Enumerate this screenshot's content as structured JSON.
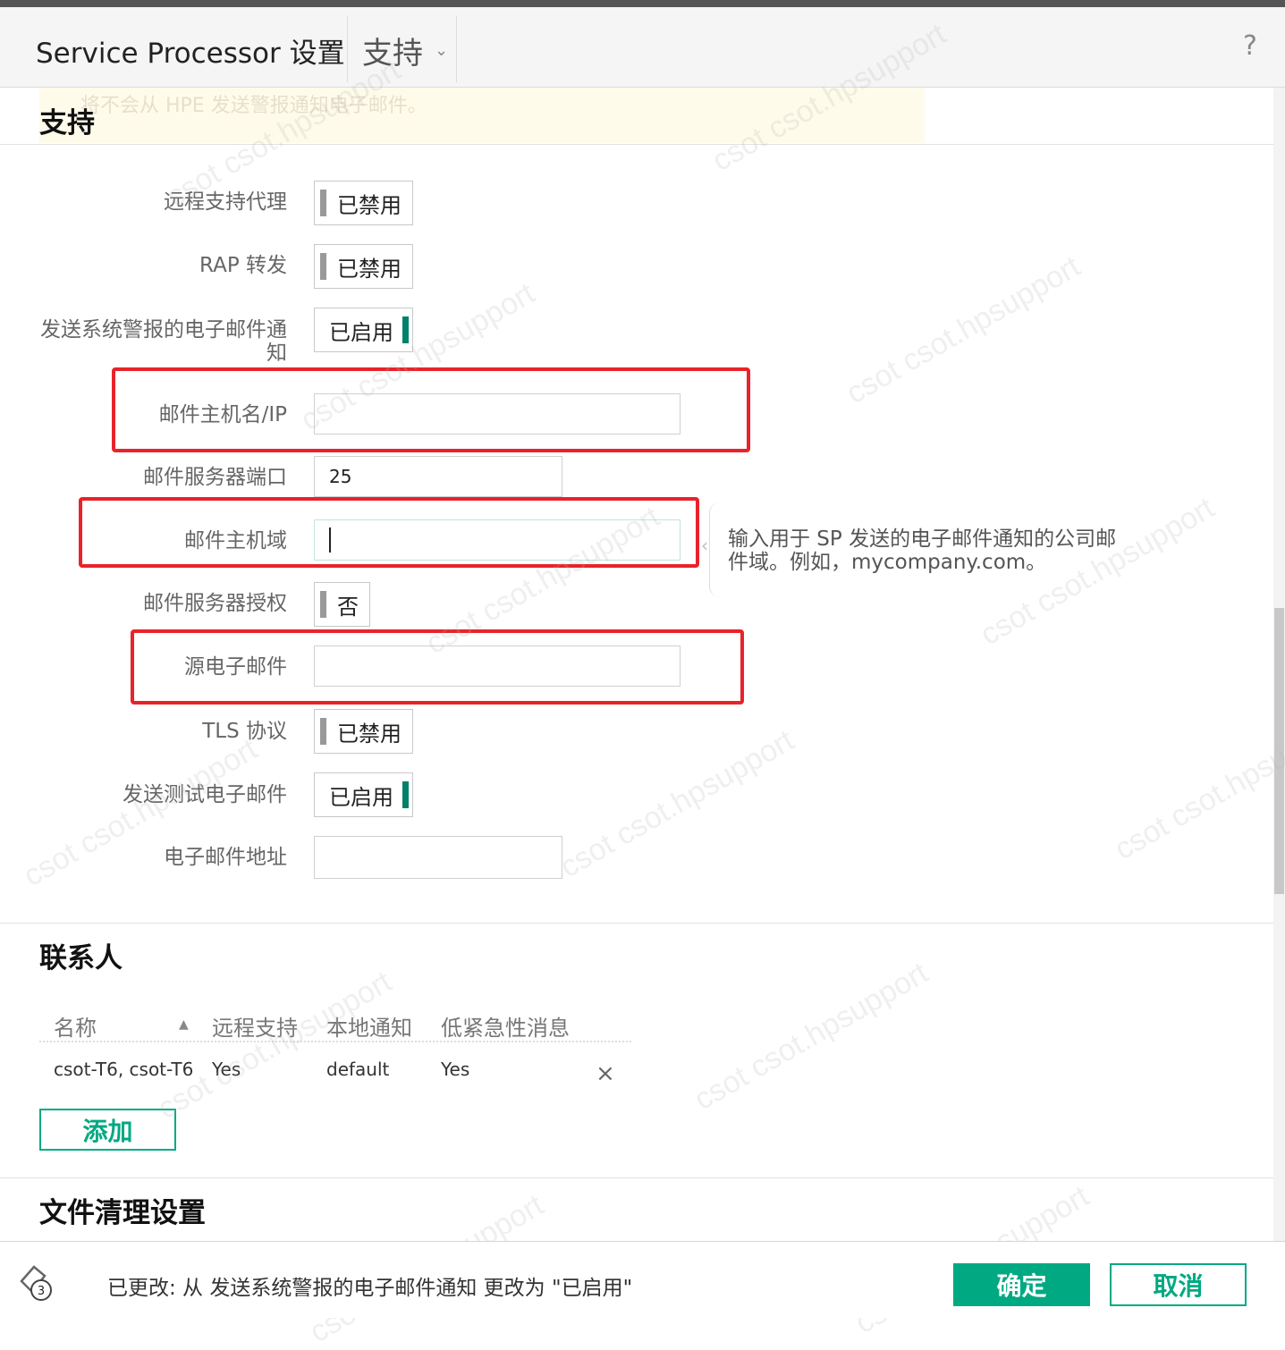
{
  "header": {
    "title": "Service Processor 设置",
    "tab": "支持",
    "help": "?"
  },
  "warning_text": "将不会从 HPE 发送警报通知电子邮件。",
  "support": {
    "title": "支持",
    "fields": [
      {
        "label": "远程支持代理",
        "type": "toggle",
        "value": "已禁用",
        "state": "off"
      },
      {
        "label": "RAP 转发",
        "type": "toggle",
        "value": "已禁用",
        "state": "off"
      },
      {
        "label": "发送系统警报的电子邮件通知",
        "type": "toggle",
        "value": "已启用",
        "state": "on"
      },
      {
        "label": "邮件主机名/IP",
        "type": "input",
        "value": ""
      },
      {
        "label": "邮件服务器端口",
        "type": "input",
        "value": "25"
      },
      {
        "label": "邮件主机域",
        "type": "input",
        "value": ""
      },
      {
        "label": "邮件服务器授权",
        "type": "toggle",
        "value": "否",
        "state": "off"
      },
      {
        "label": "源电子邮件",
        "type": "input",
        "value": ""
      },
      {
        "label": "TLS 协议",
        "type": "toggle",
        "value": "已禁用",
        "state": "off"
      },
      {
        "label": "发送测试电子邮件",
        "type": "toggle",
        "value": "已启用",
        "state": "on"
      },
      {
        "label": "电子邮件地址",
        "type": "input",
        "value": ""
      }
    ],
    "tooltip": "输入用于 SP 发送的电子邮件通知的公司邮件域。例如，mycompany.com。"
  },
  "contacts": {
    "title": "联系人",
    "columns": [
      "名称",
      "远程支持",
      "本地通知",
      "低紧急性消息"
    ],
    "rows": [
      {
        "name": "csot-T6, csot-T6",
        "remote": "Yes",
        "local": "default",
        "low": "Yes"
      }
    ],
    "delete_glyph": "×",
    "add_label": "添加"
  },
  "cleanup": {
    "title": "文件清理设置"
  },
  "footer": {
    "badge": "3",
    "message": "已更改: 从 发送系统警报的电子邮件通知 更改为 \"已启用\"",
    "ok_label": "确定",
    "cancel_label": "取消"
  },
  "colors": {
    "accent": "#01a982",
    "highlight_box": "#e8232a"
  },
  "watermark": "csot csot.hpsupport"
}
